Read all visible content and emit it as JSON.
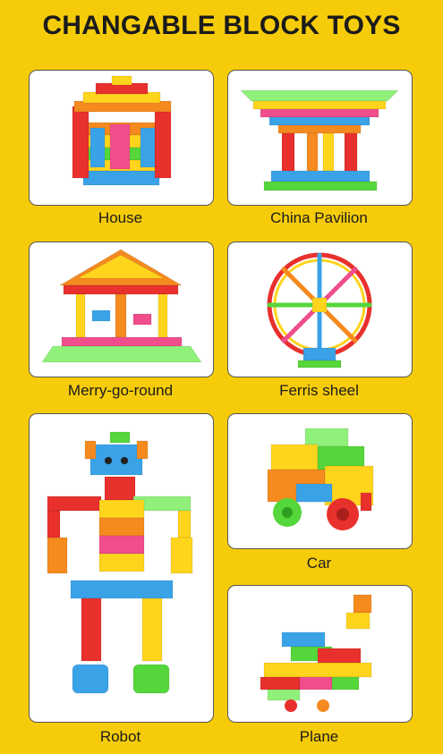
{
  "title": "CHANGABLE BLOCK TOYS",
  "products": [
    {
      "label": "House",
      "image": "house-block-toy"
    },
    {
      "label": "China Pavilion",
      "image": "pavilion-block-toy"
    },
    {
      "label": "Merry-go-round",
      "image": "carousel-block-toy"
    },
    {
      "label": "Ferris sheel",
      "image": "ferris-wheel-block-toy"
    },
    {
      "label": "Robot",
      "image": "robot-block-toy"
    },
    {
      "label": "Car",
      "image": "car-block-toy"
    },
    {
      "label": "Plane",
      "image": "plane-block-toy"
    }
  ],
  "colors": {
    "background": "#f6cc0a",
    "card": "#ffffff",
    "text": "#1b1b1b",
    "block_red": "#e8302c",
    "block_orange": "#f58a1f",
    "block_yellow": "#ffd41c",
    "block_green": "#55d63a",
    "block_blue": "#3aa3e8",
    "block_pink": "#ef4d8c"
  }
}
